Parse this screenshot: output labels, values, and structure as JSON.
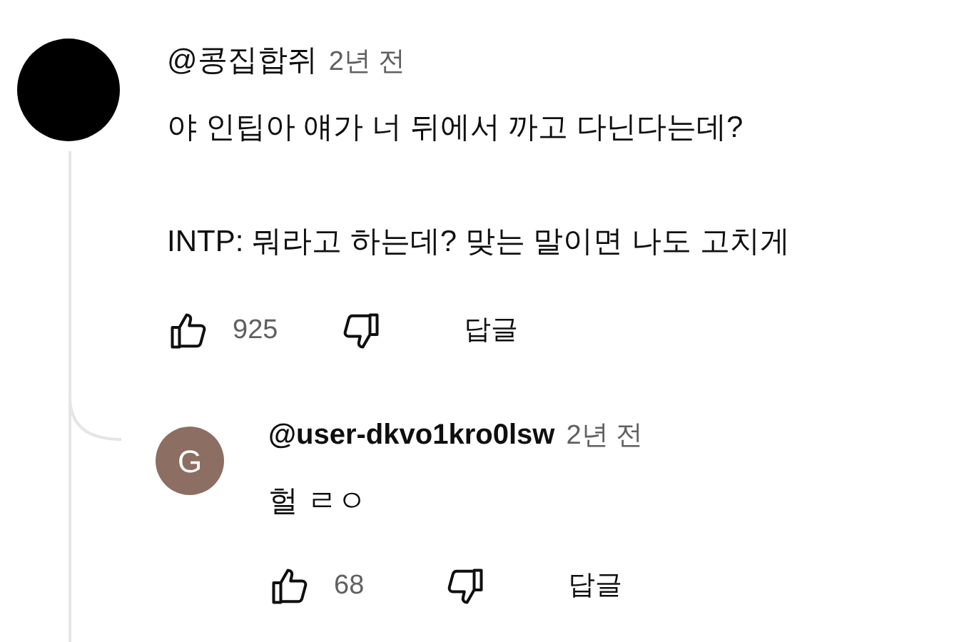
{
  "comments": [
    {
      "author": "@콩집합쥐",
      "time": "2년 전",
      "avatar": {
        "color": "#000000"
      },
      "text": "야 인팁아 얘가 너 뒤에서 까고 다닌다는데?\n\nINTP: 뭐라고 하는데? 맞는 말이면 나도 고치게",
      "likes": "925",
      "reply_label": "답글",
      "replies": [
        {
          "author": "@user-dkvo1kro0lsw",
          "time": "2년 전",
          "avatar": {
            "letter": "G",
            "color": "#8d6e63"
          },
          "text": "헐 ㄹㅇ",
          "likes": "68",
          "reply_label": "답글"
        }
      ]
    }
  ]
}
